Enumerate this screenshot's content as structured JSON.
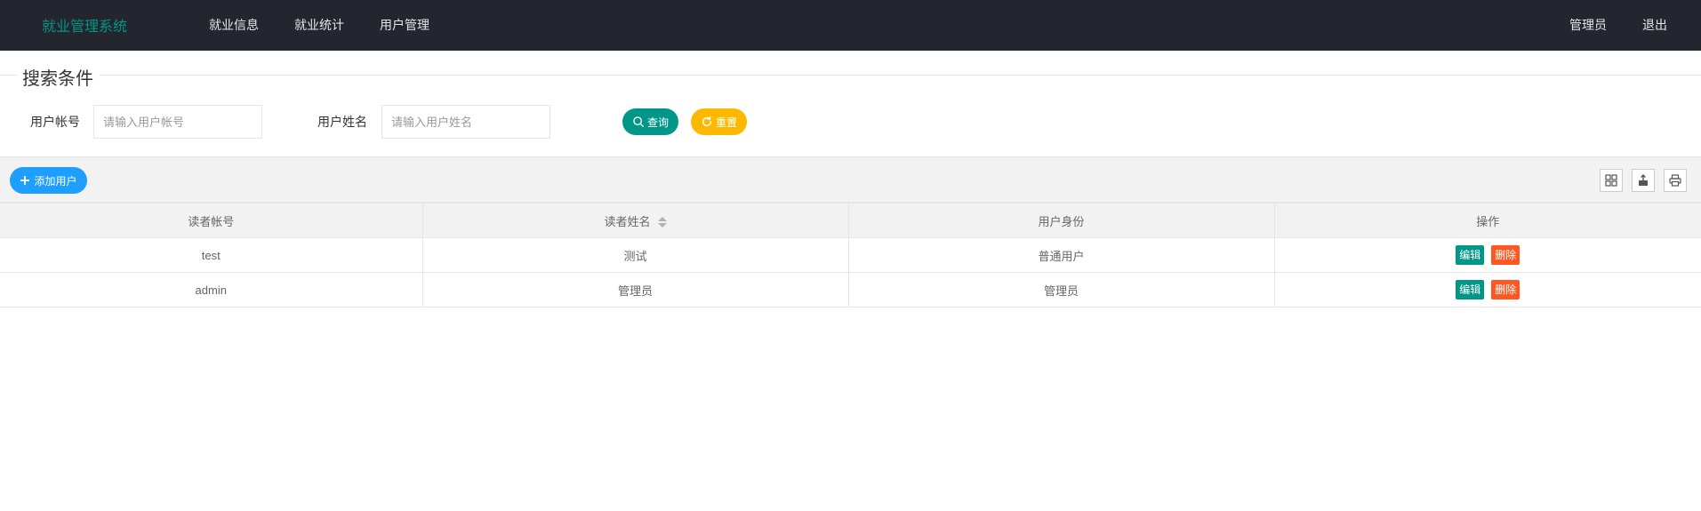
{
  "header": {
    "logo": "就业管理系统",
    "nav": [
      "就业信息",
      "就业统计",
      "用户管理"
    ],
    "user": "管理员",
    "logout": "退出"
  },
  "search": {
    "legend": "搜索条件",
    "account_label": "用户帐号",
    "account_placeholder": "请输入用户帐号",
    "name_label": "用户姓名",
    "name_placeholder": "请输入用户姓名",
    "search_button": "查询",
    "reset_button": "重置"
  },
  "toolbar": {
    "add_button": "添加用户",
    "icons": [
      "columns-icon",
      "export-icon",
      "print-icon"
    ]
  },
  "table": {
    "headers": [
      "读者帐号",
      "读者姓名",
      "用户身份",
      "操作"
    ],
    "rows": [
      {
        "account": "test",
        "name": "测试",
        "role": "普通用户",
        "edit": "编辑",
        "delete": "删除"
      },
      {
        "account": "admin",
        "name": "管理员",
        "role": "管理员",
        "edit": "编辑",
        "delete": "删除"
      }
    ]
  },
  "colors": {
    "header_bg": "#23262e",
    "logo": "#009688",
    "search": "#009688",
    "reset": "#ffb800",
    "add": "#1e9fff",
    "edit": "#009688",
    "delete": "#ff5722"
  }
}
